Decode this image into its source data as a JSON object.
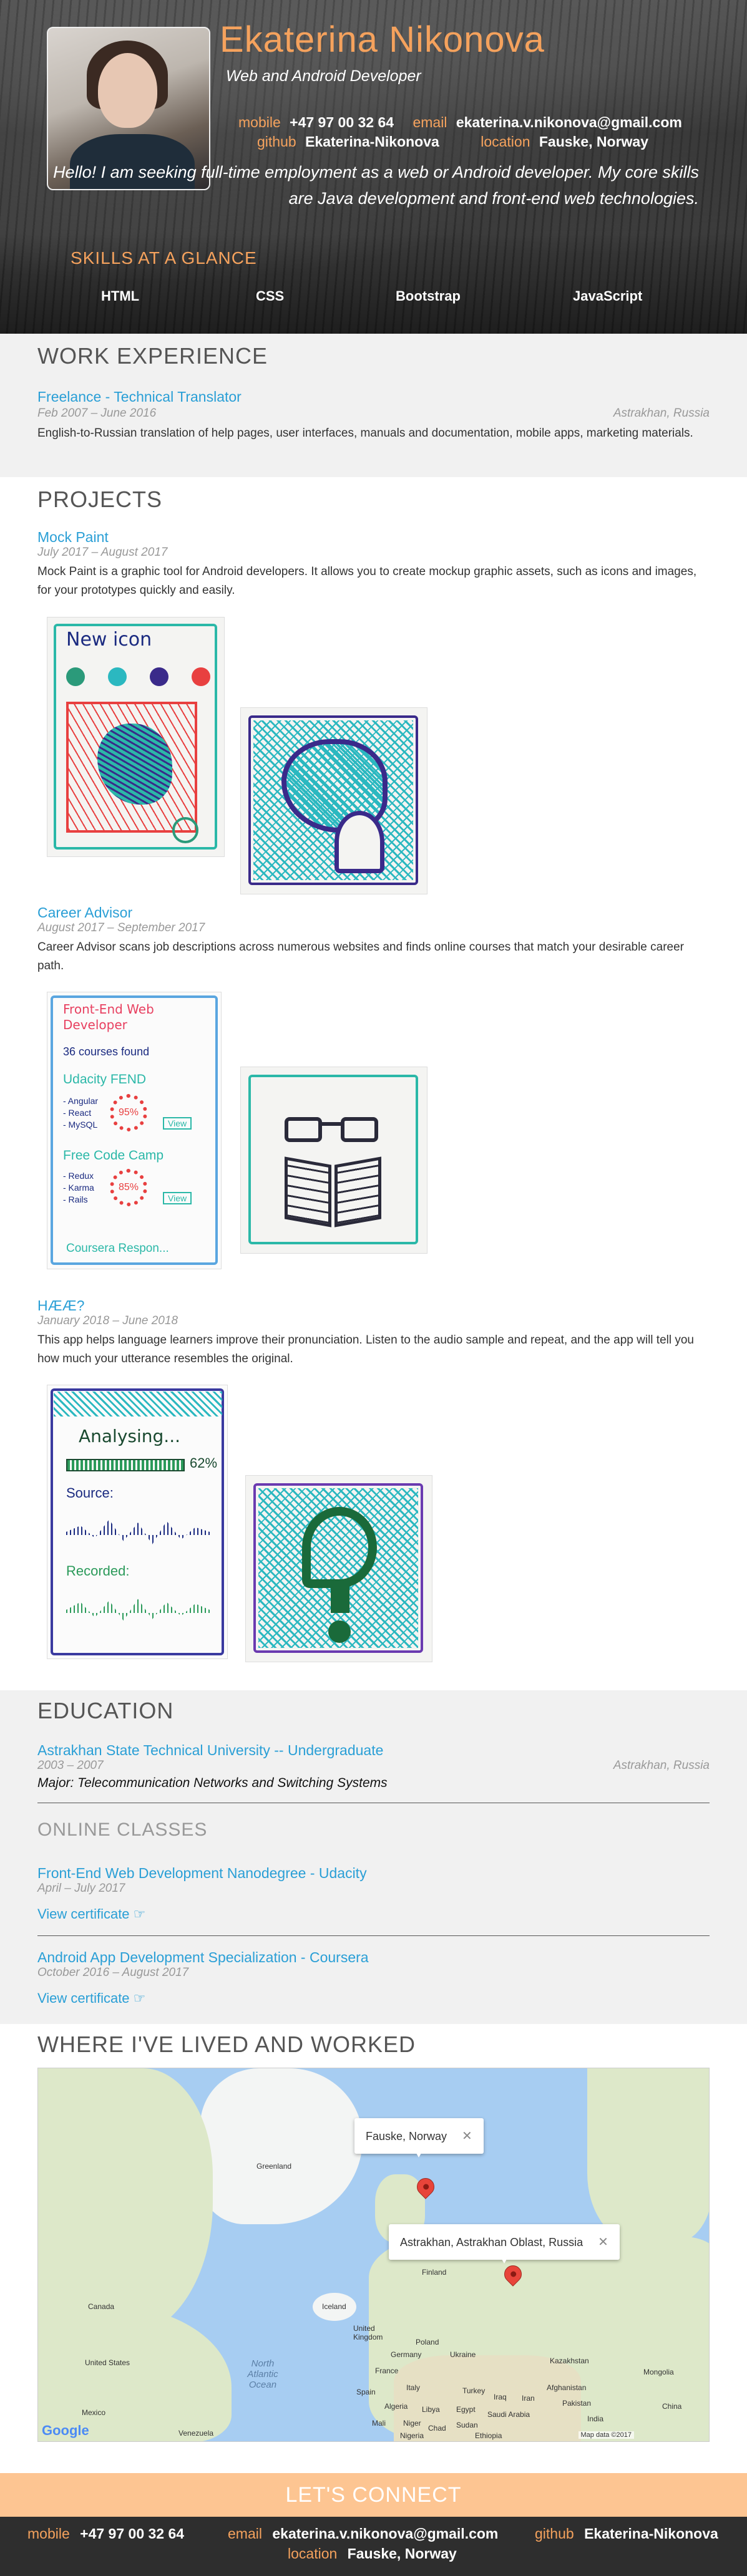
{
  "header": {
    "name": "Ekaterina Nikonova",
    "role": "Web and Android Developer",
    "contacts": {
      "mobile_label": "mobile",
      "mobile": "+47 97 00 32 64",
      "email_label": "email",
      "email": "ekaterina.v.nikonova@gmail.com",
      "github_label": "github",
      "github": "Ekaterina-Nikonova",
      "location_label": "location",
      "location": "Fauske, Norway"
    },
    "intro": "Hello! I am seeking full-time employment as a web or Android developer. My core skills are Java development and front-end web technologies.",
    "skills_title": "SKILLS AT A GLANCE",
    "skills": [
      "HTML",
      "CSS",
      "Bootstrap",
      "JavaScript"
    ]
  },
  "work": {
    "heading": "WORK EXPERIENCE",
    "jobs": [
      {
        "title": "Freelance - Technical Translator",
        "dates": "Feb 2007 – June 2016",
        "location": "Astrakhan, Russia",
        "description": "English-to-Russian translation of help pages, user interfaces, manuals and documentation, mobile apps, marketing materials."
      }
    ]
  },
  "projects": {
    "heading": "PROJECTS",
    "items": [
      {
        "title": "Mock Paint",
        "dates": "July 2017 – August 2017",
        "description": "Mock Paint is a graphic tool for Android developers. It allows you to create mockup graphic assets, such as icons and images, for your prototypes quickly and easily.",
        "sketch_text": "New icon"
      },
      {
        "title": "Career Advisor",
        "dates": "August 2017 – September 2017",
        "description": "Career Advisor scans job descriptions across numerous websites and finds online courses that match your desirable career path.",
        "sketch_lines": [
          "Front-End Web",
          "Developer",
          "36 courses found",
          "Udacity FEND",
          "- Angular",
          "- React",
          "- MySQL",
          "95%",
          "View",
          "Free Code Camp",
          "- Redux",
          "- Karma",
          "- Rails",
          "85%",
          "View",
          "Coursera Respon..."
        ]
      },
      {
        "title": "HÆÆ?",
        "dates": "January 2018 – June 2018",
        "description": "This app helps language learners improve their pronunciation. Listen to the audio sample and repeat, and the app will tell you how much your utterance resembles the original.",
        "sketch_lines": [
          "Analysing...",
          "62%",
          "Source:",
          "Recorded:"
        ]
      }
    ]
  },
  "education": {
    "heading": "EDUCATION",
    "school": "Astrakhan State Technical University -- Undergraduate",
    "dates": "2003 – 2007",
    "location": "Astrakhan, Russia",
    "major": "Major: Telecommunication Networks and Switching Systems",
    "online_heading": "ONLINE CLASSES",
    "classes": [
      {
        "title": "Front-End Web Development Nanodegree - Udacity",
        "dates": "April – July 2017",
        "link": "View certificate ☞"
      },
      {
        "title": "Android App Development Specialization - Coursera",
        "dates": "October 2016 – August 2017",
        "link": "View certificate ☞"
      }
    ]
  },
  "map": {
    "heading": "WHERE I'VE LIVED AND WORKED",
    "info_norway": "Fauske, Norway",
    "info_russia": "Astrakhan, Astrakhan Oblast, Russia",
    "close_glyph": "✕",
    "labels": {
      "greenland": "Greenland",
      "iceland": "Iceland",
      "finland": "Finland",
      "uk": "United Kingdom",
      "poland": "Poland",
      "germany": "Germany",
      "ukraine": "Ukraine",
      "france": "France",
      "spain": "Spain",
      "italy": "Italy",
      "turkey": "Turkey",
      "kazakhstan": "Kazakhstan",
      "mongolia": "Mongolia",
      "china": "China",
      "canada": "Canada",
      "us": "United States",
      "mexico": "Mexico",
      "venezuela": "Venezuela",
      "algeria": "Algeria",
      "libya": "Libya",
      "egypt": "Egypt",
      "mali": "Mali",
      "niger": "Niger",
      "chad": "Chad",
      "sudan": "Sudan",
      "nigeria": "Nigeria",
      "ethiopia": "Ethiopia",
      "saudi": "Saudi Arabia",
      "iraq": "Iraq",
      "iran": "Iran",
      "afghanistan": "Afghanistan",
      "pakistan": "Pakistan",
      "india": "India",
      "ocean": "North Atlantic Ocean",
      "google": "Google",
      "mapdata": "Map data ©2017"
    }
  },
  "footer": {
    "connect": "LET'S CONNECT"
  },
  "colors": {
    "accent": "#f5a25d",
    "link": "#2a9fd6",
    "footer": "#2e2e2e",
    "connect": "#fdc592"
  }
}
